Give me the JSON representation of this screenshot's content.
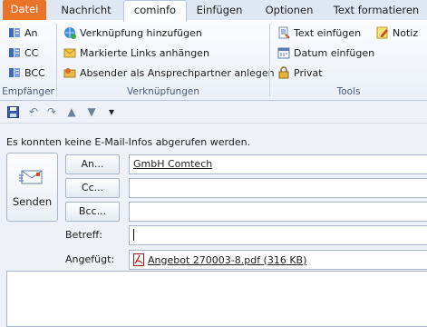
{
  "tabs": [
    "Datei",
    "Nachricht",
    "cominfo",
    "Einfügen",
    "Optionen",
    "Text formatieren"
  ],
  "ribbon": {
    "empfaenger": {
      "items": [
        "An",
        "CC",
        "BCC"
      ],
      "label": "Empfänger"
    },
    "verknuepfungen": {
      "items": [
        "Verknüpfung hinzufügen",
        "Markierte Links anhängen",
        "Absender als Ansprechpartner anlegen"
      ],
      "label": "Verknüpfungen"
    },
    "tools": {
      "items": [
        "Text einfügen",
        "Datum einfügen",
        "Privat",
        "Notiz"
      ],
      "label": "Tools"
    }
  },
  "qat": {
    "icons": [
      "save-icon",
      "undo-icon",
      "redo-icon",
      "up-arrow-icon",
      "down-arrow-icon",
      "customize-icon"
    ]
  },
  "info": "Es konnten keine E-Mail-Infos abgerufen werden.",
  "compose": {
    "send_label": "Senden",
    "to_button": "An...",
    "cc_button": "Cc...",
    "bcc_button": "Bcc...",
    "to_value": "GmbH Comtech",
    "cc_value": "",
    "bcc_value": "",
    "subject_label": "Betreff:",
    "subject_value": "",
    "attached_label": "Angefügt:",
    "attachment": "Angebot 270003-8.pdf (316 KB)"
  },
  "colors": {
    "file_tab": "#e8742a",
    "ribbon_bg": "#eaf0f8",
    "border": "#a9b6c8"
  }
}
